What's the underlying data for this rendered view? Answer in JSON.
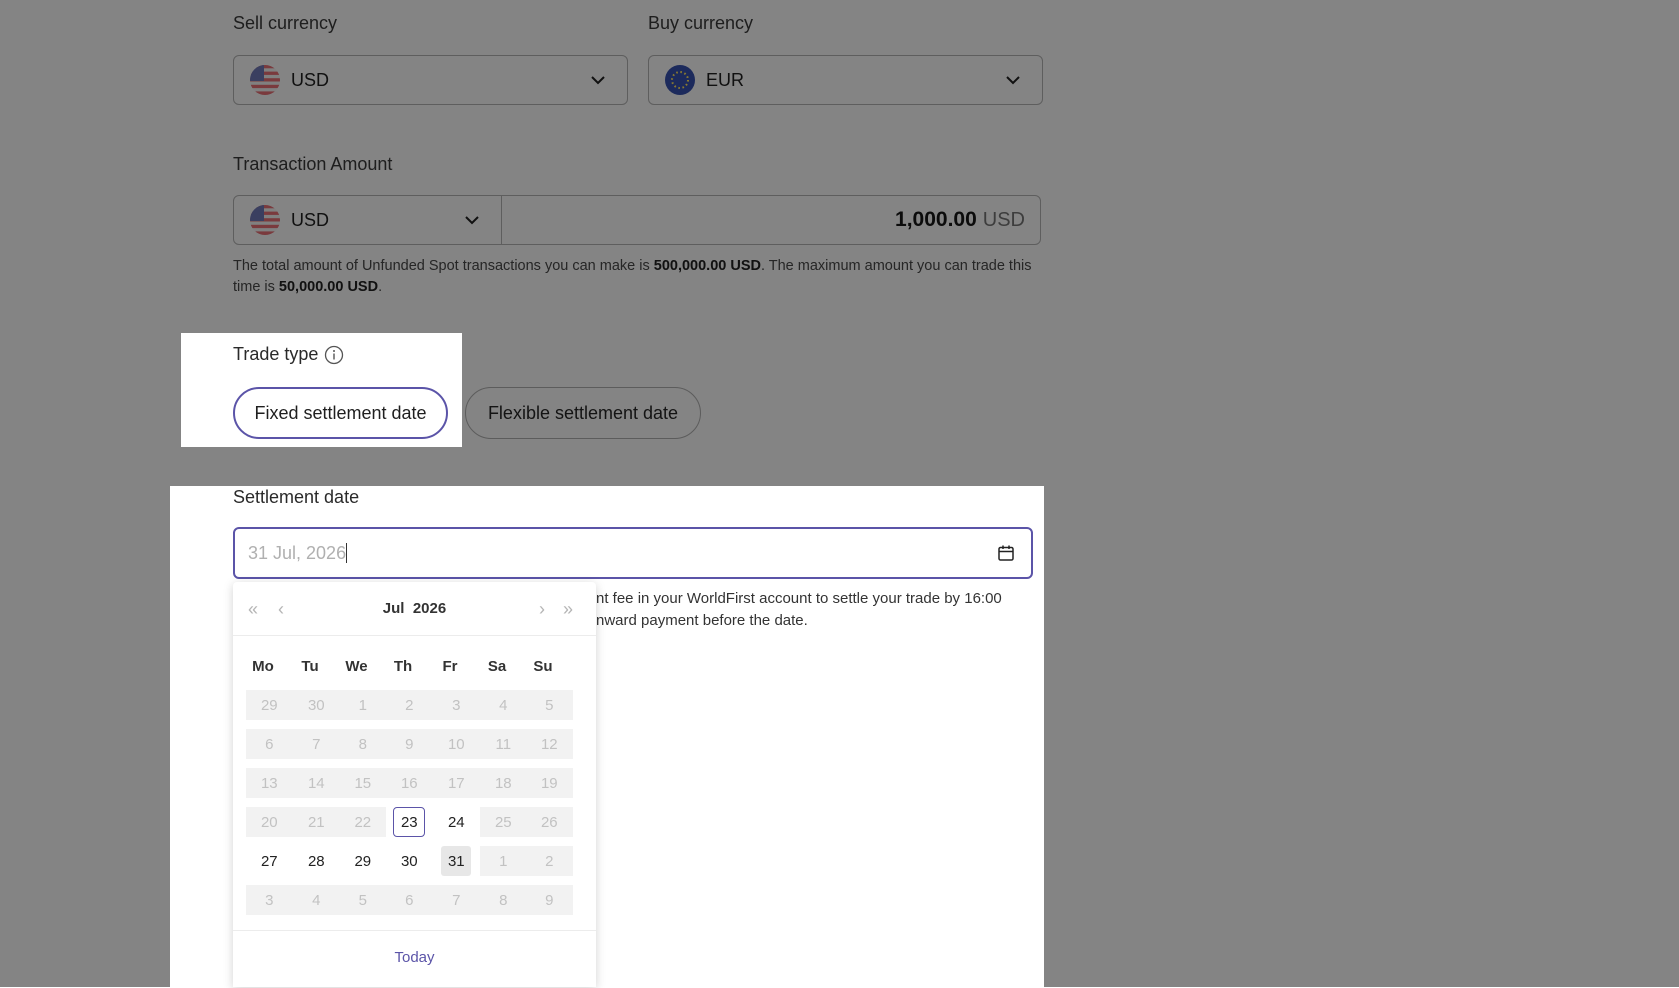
{
  "sell_currency": {
    "label": "Sell currency",
    "value": "USD",
    "flag": "us-flag-icon"
  },
  "buy_currency": {
    "label": "Buy currency",
    "value": "EUR",
    "flag": "eu-flag-icon"
  },
  "transaction": {
    "label": "Transaction Amount",
    "currency": "USD",
    "amount": "1,000.00",
    "amount_unit": "USD",
    "helper_pre": "The total amount of Unfunded Spot transactions you can make is ",
    "helper_total": "500,000.00 USD",
    "helper_mid": ". The maximum amount you can trade this time is ",
    "helper_max": "50,000.00 USD",
    "helper_end": "."
  },
  "trade_type": {
    "label": "Trade type",
    "options": [
      "Fixed settlement date",
      "Flexible settlement date"
    ],
    "selected": "Fixed settlement date"
  },
  "settlement": {
    "label": "Settlement date",
    "value": "31 Jul, 2026",
    "note_line1": "nt fee in your WorldFirst account to settle your trade by 16:00",
    "note_line2": "nward payment before the date."
  },
  "calendar": {
    "month": "Jul",
    "year": "2026",
    "weekdays": [
      "Mo",
      "Tu",
      "We",
      "Th",
      "Fr",
      "Sa",
      "Su"
    ],
    "weeks": [
      [
        "29",
        "30",
        "1",
        "2",
        "3",
        "4",
        "5"
      ],
      [
        "6",
        "7",
        "8",
        "9",
        "10",
        "11",
        "12"
      ],
      [
        "13",
        "14",
        "15",
        "16",
        "17",
        "18",
        "19"
      ],
      [
        "20",
        "21",
        "22",
        "23",
        "24",
        "25",
        "26"
      ],
      [
        "27",
        "28",
        "29",
        "30",
        "31",
        "1",
        "2"
      ],
      [
        "3",
        "4",
        "5",
        "6",
        "7",
        "8",
        "9"
      ]
    ],
    "today": "23",
    "selected": "31",
    "today_label": "Today",
    "accent": "#5b54a8"
  }
}
